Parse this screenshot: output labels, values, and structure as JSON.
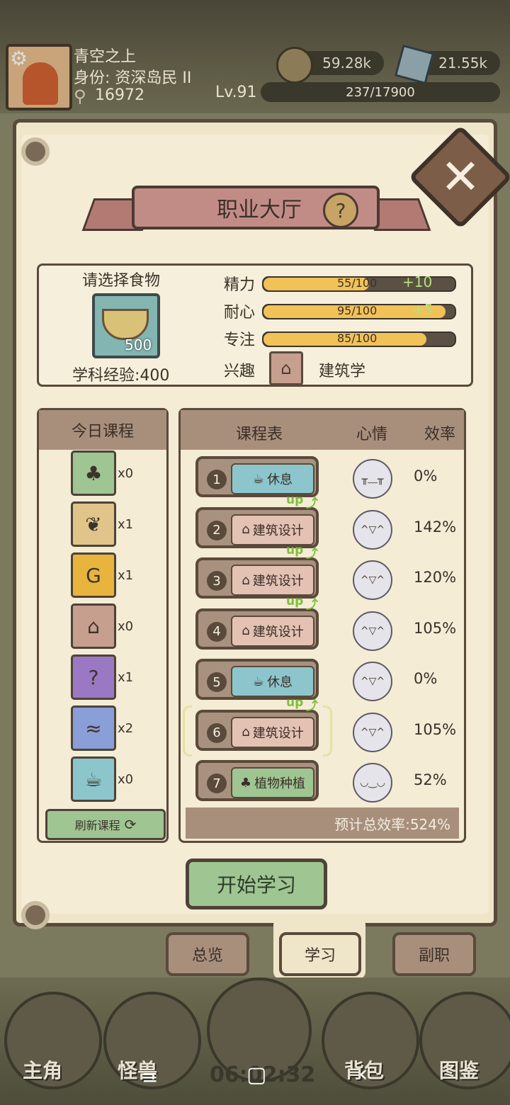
{
  "player": {
    "name": "青空之上",
    "identity": "身份: 资深岛民 II",
    "power": "16972",
    "level": "Lv.91",
    "exp": "237/17900",
    "coins": "59.28k",
    "gems": "21.55k"
  },
  "panel": {
    "title": "职业大厅",
    "help": "?",
    "close": "✕"
  },
  "info": {
    "food_prompt": "请选择食物",
    "food_count": "500",
    "subject_exp": "学科经验:400",
    "stats": [
      {
        "label": "精力",
        "value": "55/100",
        "bonus": "+10",
        "fraction": 0.55
      },
      {
        "label": "耐心",
        "value": "95/100",
        "bonus": "+5",
        "fraction": 0.95
      },
      {
        "label": "专注",
        "value": "85/100",
        "bonus": "",
        "fraction": 0.85
      }
    ],
    "interest_label": "兴趣",
    "interest_value": "建筑学"
  },
  "today": {
    "header": "今日课程",
    "courses": [
      {
        "icon": "leaf-icon",
        "glyph": "♣",
        "color": "#9fc592",
        "count": "x0"
      },
      {
        "icon": "paw-icon",
        "glyph": "❦",
        "color": "#e0c48a",
        "count": "x1"
      },
      {
        "icon": "money-bag-icon",
        "glyph": "G",
        "color": "#e8b43e",
        "count": "x1"
      },
      {
        "icon": "house-icon",
        "glyph": "⌂",
        "color": "#c79f8f",
        "count": "x0"
      },
      {
        "icon": "potion-icon",
        "glyph": "?",
        "color": "#9a78c4",
        "count": "x1"
      },
      {
        "icon": "water-book-icon",
        "glyph": "≈",
        "color": "#8a9ed8",
        "count": "x2"
      },
      {
        "icon": "cup-icon",
        "glyph": "☕",
        "color": "#8cc6cc",
        "count": "x0"
      }
    ],
    "refresh": "刷新课程"
  },
  "schedule": {
    "header_course": "课程表",
    "header_mood": "心情",
    "header_eff": "效率",
    "up_label": "up",
    "rows": [
      {
        "num": "1",
        "course": "休息",
        "icon": "cup-icon",
        "glyph": "☕",
        "color": "#8cc6cc",
        "up": false,
        "mood": "crying-face-icon",
        "face": "╥﹏╥",
        "eff": "0%"
      },
      {
        "num": "2",
        "course": "建筑设计",
        "icon": "house-icon",
        "glyph": "⌂",
        "color": "#e3c2b4",
        "up": true,
        "mood": "happy-face-icon",
        "face": "^▽^",
        "eff": "142%"
      },
      {
        "num": "3",
        "course": "建筑设计",
        "icon": "house-icon",
        "glyph": "⌂",
        "color": "#e3c2b4",
        "up": true,
        "mood": "happy-face-icon",
        "face": "^▽^",
        "eff": "120%"
      },
      {
        "num": "4",
        "course": "建筑设计",
        "icon": "house-icon",
        "glyph": "⌂",
        "color": "#e3c2b4",
        "up": true,
        "mood": "happy-face-icon",
        "face": "^▽^",
        "eff": "105%"
      },
      {
        "num": "5",
        "course": "休息",
        "icon": "cup-icon",
        "glyph": "☕",
        "color": "#8cc6cc",
        "up": false,
        "mood": "happy-face-icon",
        "face": "^▽^",
        "eff": "0%"
      },
      {
        "num": "6",
        "course": "建筑设计",
        "icon": "house-icon",
        "glyph": "⌂",
        "color": "#e3c2b4",
        "up": true,
        "mood": "happy-face-icon",
        "face": "^▽^",
        "eff": "105%"
      },
      {
        "num": "7",
        "course": "植物种植",
        "icon": "leaf-icon",
        "glyph": "♣",
        "color": "#9fc592",
        "up": false,
        "mood": "calm-face-icon",
        "face": "◡‿◡",
        "eff": "52%"
      }
    ],
    "total": "预计总效率:524%"
  },
  "start_button": "开始学习",
  "tabs": [
    "总览",
    "学习",
    "副职"
  ],
  "nav": [
    "主角",
    "怪兽",
    "背包",
    "图鉴"
  ],
  "clock": "06:02:32",
  "system": {
    "menu": "≡",
    "home": "▢",
    "back": "‹"
  }
}
